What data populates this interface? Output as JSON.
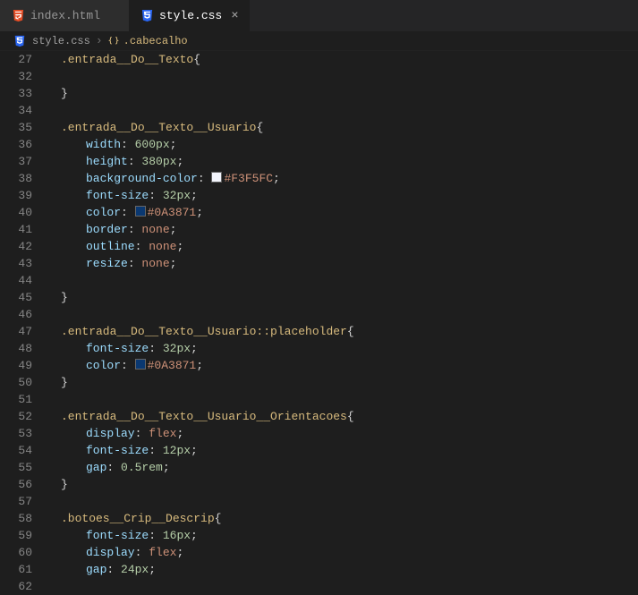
{
  "tabs": [
    {
      "label": "index.html",
      "icon": "html5-icon",
      "active": false
    },
    {
      "label": "style.css",
      "icon": "css3-icon",
      "active": true
    }
  ],
  "breadcrumb": {
    "file_icon": "css3-icon",
    "file_label": "style.css",
    "symbol_icon": "braces-icon",
    "symbol_label": ".cabecalho"
  },
  "line_numbers": [
    "27",
    "32",
    "33",
    "34",
    "35",
    "36",
    "37",
    "38",
    "39",
    "40",
    "41",
    "42",
    "43",
    "44",
    "45",
    "46",
    "47",
    "48",
    "49",
    "50",
    "51",
    "52",
    "53",
    "54",
    "55",
    "56",
    "57",
    "58",
    "59",
    "60",
    "61",
    "62"
  ],
  "code": {
    "r27_selector": ".entrada__Do__Texto",
    "r35_selector": ".entrada__Do__Texto__Usuario",
    "r36_prop": "width",
    "r36_num": "600",
    "r36_unit": "px",
    "r37_prop": "height",
    "r37_num": "380",
    "r37_unit": "px",
    "r38_prop": "background-color",
    "r38_hex": "#F3F5FC",
    "r39_prop": "font-size",
    "r39_num": "32",
    "r39_unit": "px",
    "r40_prop": "color",
    "r40_hex": "#0A3871",
    "r41_prop": "border",
    "r41_kw": "none",
    "r42_prop": "outline",
    "r42_kw": "none",
    "r43_prop": "resize",
    "r43_kw": "none",
    "r47_selector": ".entrada__Do__Texto__Usuario::placeholder",
    "r48_prop": "font-size",
    "r48_num": "32",
    "r48_unit": "px",
    "r49_prop": "color",
    "r49_hex": "#0A3871",
    "r52_selector": ".entrada__Do__Texto__Usuario__Orientacoes",
    "r53_prop": "display",
    "r53_kw": "flex",
    "r54_prop": "font-size",
    "r54_num": "12",
    "r54_unit": "px",
    "r55_prop": "gap",
    "r55_num": "0.5",
    "r55_unit": "rem",
    "r58_selector": ".botoes__Crip__Descrip",
    "r59_prop": "font-size",
    "r59_num": "16",
    "r59_unit": "px",
    "r60_prop": "display",
    "r60_kw": "flex",
    "r61_prop": "gap",
    "r61_num": "24",
    "r61_unit": "px"
  },
  "colors": {
    "swatch_F3F5FC": "#F3F5FC",
    "swatch_0A3871": "#0A3871"
  }
}
